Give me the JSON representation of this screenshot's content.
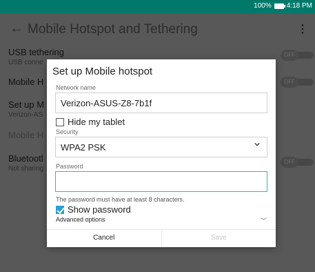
{
  "status_bar": {
    "battery": "100%",
    "time": "4:18 PM"
  },
  "app_bar": {
    "title": "Mobile Hotspot and Tethering",
    "back_icon": "arrow-back-icon",
    "more_icon": "more-vert-icon"
  },
  "settings": [
    {
      "title": "USB tethering",
      "subtitle": "USB conne",
      "toggle": "OFF"
    },
    {
      "title": "Mobile H",
      "toggle": "OFF"
    },
    {
      "title": "Set up M",
      "subtitle": "Verizon-AS"
    },
    {
      "title": "Mobile H",
      "disabled": true
    },
    {
      "title": "Bluetootl",
      "subtitle": "Not sharing",
      "toggle": "OFF"
    }
  ],
  "dialog": {
    "title": "Set up Mobile hotspot",
    "network_name_label": "Network name",
    "network_name_value": "Verizon-ASUS-Z8-7b1f",
    "hide_label": "Hide my tablet",
    "hide_checked": false,
    "security_label": "Security",
    "security_value": "WPA2 PSK",
    "password_label": "Password",
    "password_value": "",
    "password_hint": "The password must have at least 8 characters.",
    "show_password_label": "Show password",
    "show_password_checked": true,
    "advanced_label": "Advanced options",
    "cancel_label": "Cancel",
    "save_label": "Save"
  },
  "colors": {
    "accent": "#2a9fd6",
    "focus_border": "#4aa8c9",
    "status_bar": "#00796b"
  }
}
